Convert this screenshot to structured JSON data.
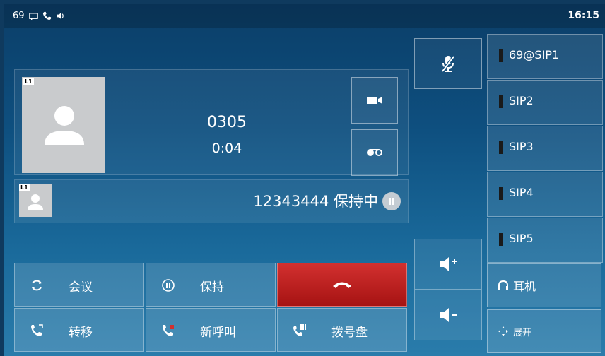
{
  "status": {
    "account_number": "69",
    "time": "16:15"
  },
  "call": {
    "line_badge": "L1",
    "number": "0305",
    "duration": "0:04"
  },
  "held_call": {
    "line_badge": "L1",
    "text": "12343444 保持中"
  },
  "line_keys": [
    {
      "label": "69@SIP1"
    },
    {
      "label": "SIP2"
    },
    {
      "label": "SIP3"
    },
    {
      "label": "SIP4"
    },
    {
      "label": "SIP5"
    }
  ],
  "func_keys": {
    "headset": "耳机",
    "expand": "展开"
  },
  "softkeys": {
    "conference": "会议",
    "hold": "保持",
    "transfer": "转移",
    "new_call": "新呼叫",
    "dialpad": "拨号盘"
  },
  "colors": {
    "end_call": "#c72423",
    "background": "#0e4f7f"
  }
}
